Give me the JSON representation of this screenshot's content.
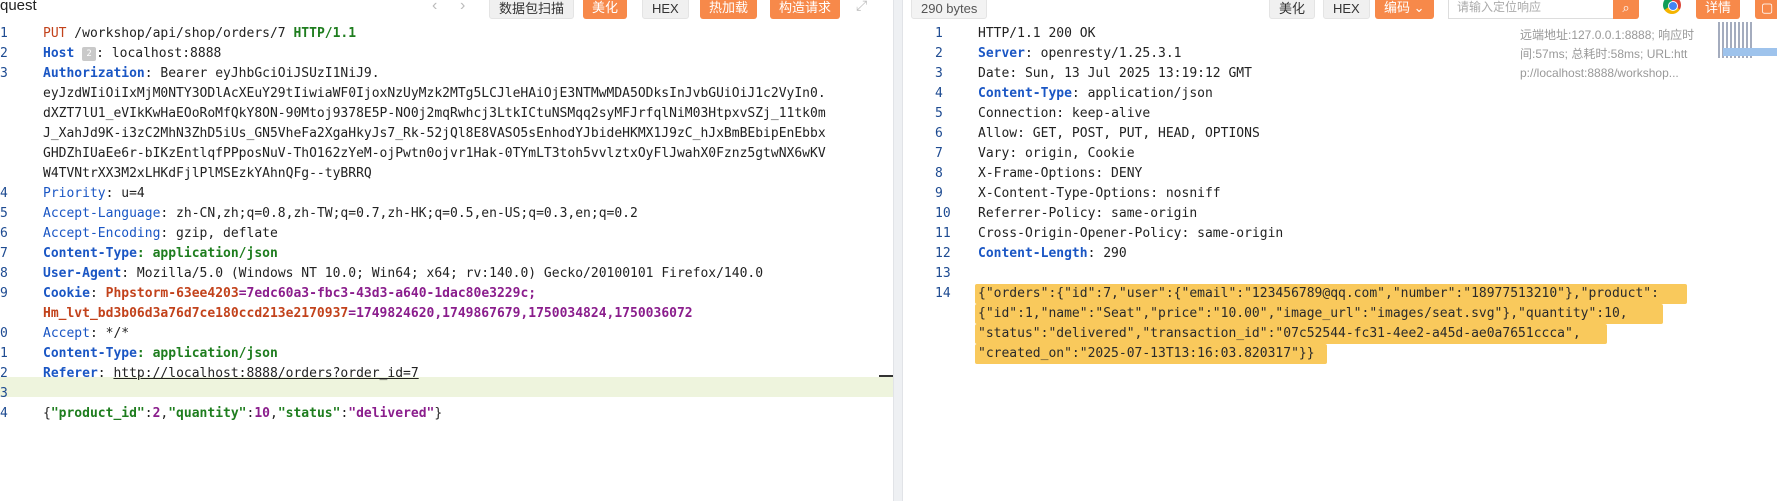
{
  "request": {
    "title": "quest",
    "toolbar": {
      "capture_label": "数据包扫描",
      "beautify_label": "美化",
      "hex_label": "HEX",
      "hotload_label": "热加载",
      "build_label": "构造请求"
    },
    "line_numbers": [
      "1",
      "2",
      "3",
      "",
      "",
      "",
      "",
      "",
      "4",
      "5",
      "6",
      "7",
      "8",
      "9",
      "",
      "0",
      "1",
      "2",
      "3",
      "4"
    ],
    "request_line": {
      "method": "PUT",
      "path": " /workshop/api/shop/orders/7 ",
      "protocol": "HTTP/1.1"
    },
    "host": {
      "key": "Host",
      "badge": "2",
      "value": ": localhost:8888"
    },
    "authorization": {
      "key": "Authorization",
      "lines": [
        ": Bearer eyJhbGciOiJSUzI1NiJ9.",
        "eyJzdWIiOiIxMjM0NTY3ODlAcXEuY29tIiwiaWF0IjoxNzUyMzk2MTg5LCJleHAiOjE3NTMwMDA5ODksInJvbGUiOiJ1c2VyIn0.",
        "dXZT7lU1_eVIkKwHaEOoRoMfQkY8ON-90Mtoj9378E5P-NO0j2mqRwhcj3LtkICtuNSMqq2syMFJrfqlNiM03HtpxvSZj_11tk0m",
        "J_XahJd9K-i3zC2MhN3ZhD5iUs_GN5VheFa2XgaHkyJs7_Rk-52jQl8E8VASO5sEnhodYJbideHKMX1J9zC_hJxBmBEbipEnEbbx",
        "GHDZhIUaEe6r-bIKzEntlqfPPposNuV-ThO162zYeM-ojPwtn0ojvr1Hak-0TYmLT3toh5vvlztxOyFlJwahX0Fznz5gtwNX6wKV",
        "W4TVNtrXX3M2xLHKdFjlPlMSEzkYAhnQFg--tyBRRQ"
      ]
    },
    "priority": {
      "key": "Priority",
      "value": ": u=4"
    },
    "accept_language": {
      "key": "Accept-Language",
      "value": ": zh-CN,zh;q=0.8,zh-TW;q=0.7,zh-HK;q=0.5,en-US;q=0.3,en;q=0.2"
    },
    "accept_encoding": {
      "key": "Accept-Encoding",
      "value": ": gzip, deflate"
    },
    "content_type": {
      "key": "Content-Type",
      "value": ": application/json"
    },
    "user_agent": {
      "key": "User-Agent",
      "value": ": Mozilla/5.0 (Windows NT 10.0; Win64; x64; rv:140.0) Gecko/20100101 Firefox/140.0"
    },
    "cookie": {
      "key": "Cookie",
      "name1": "Phpstorm-63ee4203",
      "val1": "=7edc60a3-fbc3-43d3-a640-1dac80e3229c;",
      "name2": "Hm_lvt_bd3b06d3a76d7ce180ccd213e2170937",
      "val2": "=1749824620,1749867679,1750034824,1750036072"
    },
    "accept": {
      "key": "Accept",
      "value": ": */*"
    },
    "content_type2": {
      "key": "Content-Type",
      "value": ": application/json"
    },
    "referer": {
      "key": "Referer",
      "sep": ": ",
      "value": "http://localhost:8888/orders?order_id=7"
    },
    "body": {
      "open": "{",
      "k1": "\"product_id\"",
      "v1": "2",
      "k2": "\"quantity\"",
      "v2": "10",
      "k3": "\"status\"",
      "v3": "\"delivered\"",
      "close": "}"
    }
  },
  "response": {
    "size_label": "290 bytes",
    "toolbar": {
      "beautify_label": "美化",
      "hex_label": "HEX",
      "encoding_label": "编码",
      "search_placeholder": "请输入定位响应",
      "details_label": "详情"
    },
    "meta": {
      "line1": "远端地址:127.0.0.1:8888; 响应时",
      "line2": "间:57ms; 总耗时:58ms; URL:htt",
      "line3": "p://localhost:8888/workshop..."
    },
    "line_numbers": [
      "1",
      "2",
      "3",
      "4",
      "5",
      "6",
      "7",
      "8",
      "9",
      "10",
      "11",
      "12",
      "13",
      "14"
    ],
    "status_line": "HTTP/1.1 200 OK",
    "server": {
      "key": "Server",
      "value": ": openresty/1.25.3.1"
    },
    "date": {
      "key": "Date",
      "value": ": Sun, 13 Jul 2025 13:19:12 GMT"
    },
    "content_type": {
      "key": "Content-Type",
      "value": ": application/json"
    },
    "connection": {
      "key": "Connection",
      "value": ": keep-alive"
    },
    "allow": {
      "key": "Allow",
      "value": ": GET, POST, PUT, HEAD, OPTIONS"
    },
    "vary": {
      "key": "Vary",
      "value": ": origin, Cookie"
    },
    "xfo": {
      "key": "X-Frame-Options",
      "value": ": DENY"
    },
    "xcto": {
      "key": "X-Content-Type-Options",
      "value": ": nosniff"
    },
    "referrer_policy": {
      "key": "Referrer-Policy",
      "value": ": same-origin"
    },
    "coop": {
      "key": "Cross-Origin-Opener-Policy",
      "value": ": same-origin"
    },
    "content_length": {
      "key": "Content-Length",
      "value": ": 290"
    },
    "body_lines": [
      "{\"orders\":{\"id\":7,\"user\":{\"email\":\"123456789@qq.com\",\"number\":\"18977513210\"},\"product\":",
      "{\"id\":1,\"name\":\"Seat\",\"price\":\"10.00\",\"image_url\":\"images/seat.svg\"},\"quantity\":10,",
      "\"status\":\"delivered\",\"transaction_id\":\"07c52544-fc31-4ee2-a45d-ae0a7651ccca\",",
      "\"created_on\":\"2025-07-13T13:16:03.820317\"}}"
    ]
  }
}
